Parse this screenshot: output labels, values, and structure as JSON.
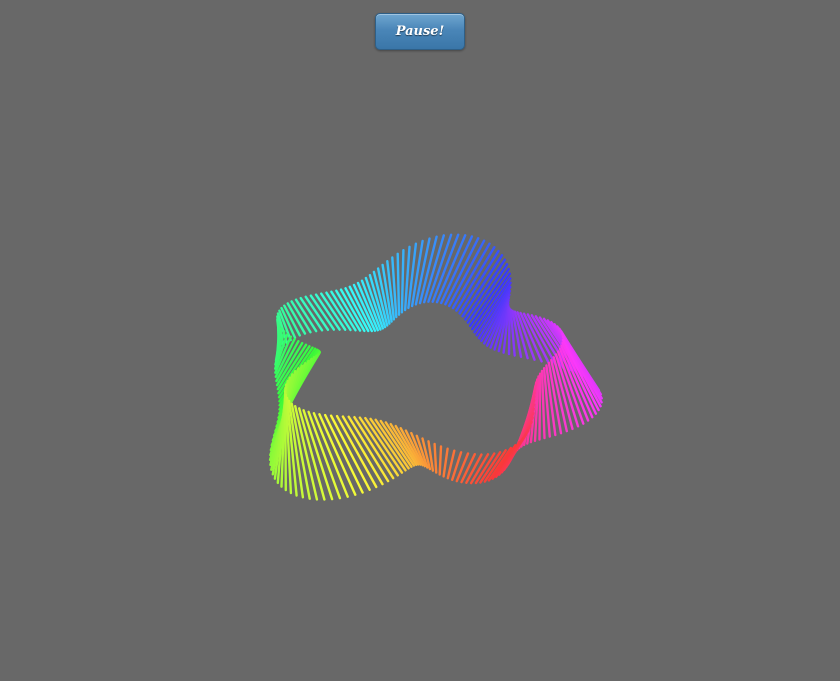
{
  "controls": {
    "pause_label": "Pause!"
  },
  "scene": {
    "background_color": "#686868",
    "object": "rainbow-twisted-ring",
    "color_mode": "hue-rainbow"
  }
}
